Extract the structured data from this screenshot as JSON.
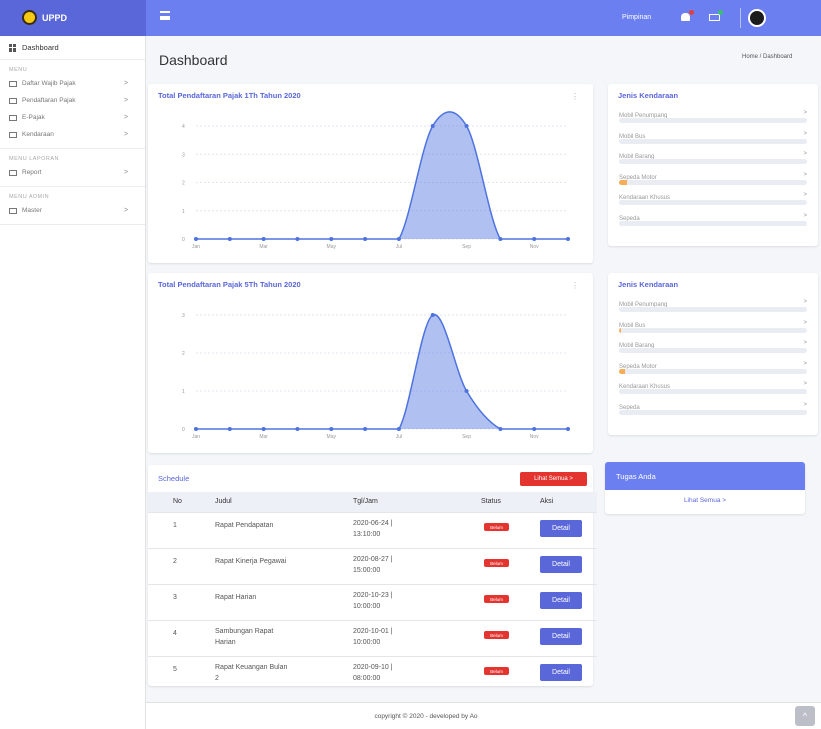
{
  "brand": {
    "name": "UPPD"
  },
  "topbar": {
    "user_name": "Pimpinan"
  },
  "sidebar": {
    "dashboard_label": "Dashboard",
    "sections": [
      "MENU",
      "MENU LAPORAN",
      "MENU ADMIN"
    ],
    "menu_items": [
      {
        "label": "Daftar Wajib Pajak",
        "chev": ">"
      },
      {
        "label": "Pendaftaran Pajak",
        "chev": ">"
      },
      {
        "label": "E-Pajak",
        "chev": ">"
      },
      {
        "label": "Kendaraan",
        "chev": ">"
      }
    ],
    "report_items": [
      {
        "label": "Report",
        "chev": ">"
      }
    ],
    "admin_items": [
      {
        "label": "Master",
        "chev": ">"
      }
    ]
  },
  "page": {
    "title": "Dashboard",
    "breadcrumb": "Home / Dashboard"
  },
  "charts": [
    {
      "title": "Total Pendaftaran Pajak 1Th Tahun 2020",
      "type": "area",
      "x_tick_labels": [
        "Jan",
        "Mar",
        "May",
        "Jul",
        "Sep",
        "Nov"
      ],
      "y_tick_labels": [
        "0",
        "1",
        "2",
        "3",
        "4"
      ],
      "ylim": [
        0,
        4
      ],
      "values": [
        0,
        0,
        0,
        0,
        0,
        0,
        0,
        4,
        4,
        0,
        0,
        0
      ],
      "color": "#4e73df"
    },
    {
      "title": "Total Pendaftaran Pajak 5Th Tahun 2020",
      "type": "area",
      "x_tick_labels": [
        "Jan",
        "Mar",
        "May",
        "Jul",
        "Sep",
        "Nov"
      ],
      "y_tick_labels": [
        "0",
        "1",
        "2",
        "3"
      ],
      "ylim": [
        0,
        3
      ],
      "values": [
        0,
        0,
        0,
        0,
        0,
        0,
        0,
        3,
        1,
        0,
        0,
        0
      ],
      "color": "#4e73df"
    }
  ],
  "vehicle_cards": [
    {
      "title": "Jenis Kendaraan",
      "items": [
        {
          "label": "Mobil Penumpang",
          "value": 0,
          "chev": ">"
        },
        {
          "label": "Mobil Bus",
          "value": 0,
          "chev": ">"
        },
        {
          "label": "Mobil Barang",
          "value": 0,
          "chev": ">"
        },
        {
          "label": "Sepeda Motor",
          "value": 0.04,
          "chev": ">"
        },
        {
          "label": "Kendaraan Khusus",
          "value": 0,
          "chev": ">"
        },
        {
          "label": "Sepeda",
          "value": 0,
          "chev": ">"
        }
      ]
    },
    {
      "title": "Jenis Kendaraan",
      "items": [
        {
          "label": "Mobil Penumpang",
          "value": 0,
          "chev": ">"
        },
        {
          "label": "Mobil Bus",
          "value": 0.01,
          "chev": ">"
        },
        {
          "label": "Mobil Barang",
          "value": 0,
          "chev": ">"
        },
        {
          "label": "Sepeda Motor",
          "value": 0.03,
          "chev": ">"
        },
        {
          "label": "Kendaraan Khusus",
          "value": 0,
          "chev": ">"
        },
        {
          "label": "Sepeda",
          "value": 0,
          "chev": ">"
        }
      ]
    }
  ],
  "schedule": {
    "title": "Schedule",
    "see_all": "Lihat Semua >",
    "headers": [
      "No",
      "Judul",
      "Tgl/Jam",
      "Status",
      "Aksi"
    ],
    "rows": [
      {
        "no": "1",
        "title": "Rapat Pendapatan",
        "date": "2020-06-24 |",
        "time": "13:10:00",
        "status": "Belum",
        "action": "Detail"
      },
      {
        "no": "2",
        "title": "Rapat Kinerja Pegawai",
        "date": "2020-08-27 |",
        "time": "15:00:00",
        "status": "Belum",
        "action": "Detail"
      },
      {
        "no": "3",
        "title": "Rapat Harian",
        "date": "2020-10-23 |",
        "time": "10:00:00",
        "status": "Belum",
        "action": "Detail"
      },
      {
        "no": "4",
        "title": "Sambungan Rapat",
        "title2": "Harian",
        "date": "2020-10-01 |",
        "time": "10:00:00",
        "status": "Belum",
        "action": "Detail"
      },
      {
        "no": "5",
        "title": "Rapat Keuangan Bulan",
        "title2": "2",
        "date": "2020-09-10 |",
        "time": "08:00:00",
        "status": "Belum",
        "action": "Detail"
      }
    ]
  },
  "tasks": {
    "title": "Tugas Anda",
    "see_all": "Lihat Semua >"
  },
  "footer": {
    "text": "copyright © 2020 - developed by Ao",
    "scroll_top": "^"
  },
  "colors": {
    "primary": "#5a67d8",
    "topbar": "#6b7ff0",
    "danger": "#e3342f",
    "progress": "#f6ad55"
  }
}
